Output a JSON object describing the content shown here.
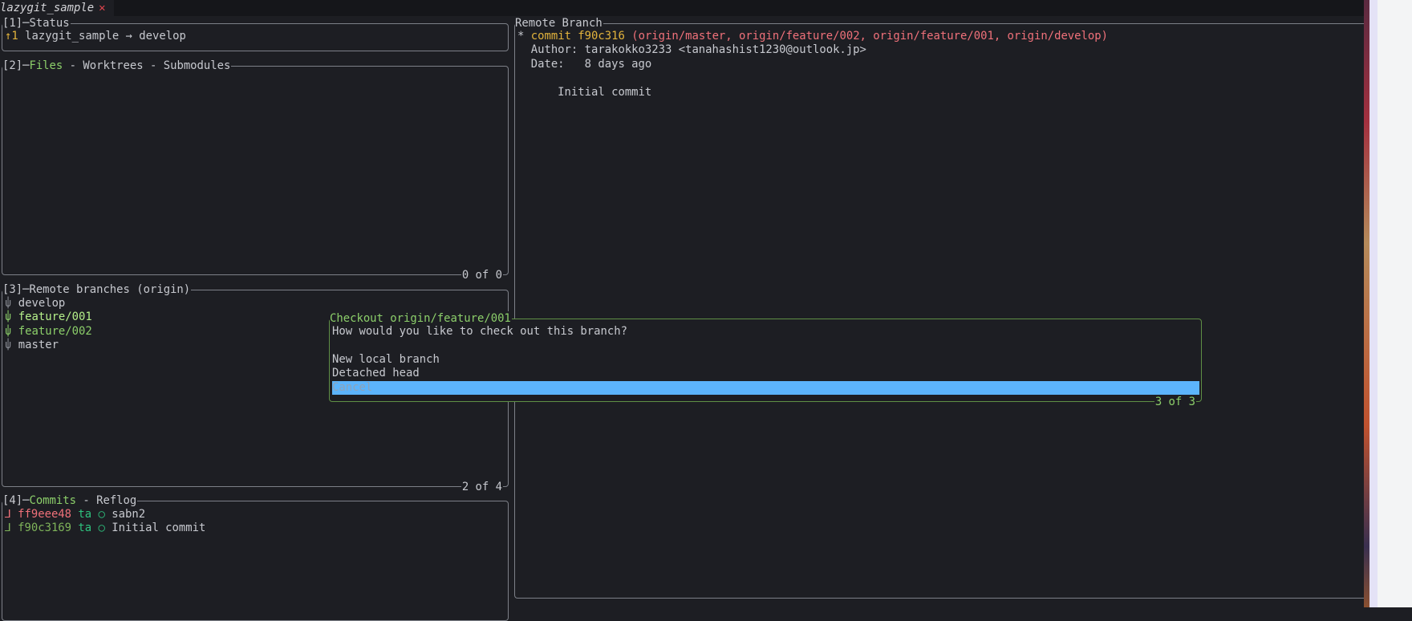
{
  "tab": {
    "title": "lazygit_sample",
    "close_icon": "✕"
  },
  "status": {
    "title": "[1]─Status",
    "ahead": "↑1",
    "text": "lazygit_sample → develop"
  },
  "files": {
    "prefix": "[2]─",
    "active": "Files",
    "rest": " - Worktrees - Submodules",
    "footer": "0 of 0"
  },
  "branches": {
    "title": "[3]─Remote branches (origin)",
    "footer": "2 of 4",
    "icon": "⍦",
    "items": [
      {
        "name": "develop"
      },
      {
        "name": "feature/001"
      },
      {
        "name": "feature/002"
      },
      {
        "name": "master"
      }
    ]
  },
  "commits": {
    "prefix": "[4]─",
    "active": "Commits",
    "rest": " - Reflog",
    "items": [
      {
        "graph": "⅃",
        "hash": "ff9eee48",
        "author": "ta",
        "mark": "○",
        "msg": "sabn2"
      },
      {
        "graph": "⅃",
        "hash": "f90c3169",
        "author": "ta",
        "mark": "○",
        "msg": "Initial commit"
      }
    ]
  },
  "detail": {
    "title": "Remote Branch",
    "star": "*",
    "commit_label": "commit f90c316",
    "refs": "(origin/master, origin/feature/002, origin/feature/001, origin/develop)",
    "author": "Author: tarakokko3233 <tanahashist1230@outlook.jp>",
    "date": "Date:   8 days ago",
    "message": "    Initial commit"
  },
  "popup": {
    "title": "Checkout origin/feature/001",
    "prompt": "How would you like to check out this branch?",
    "options": [
      "New local branch",
      "Detached head",
      "Cancel"
    ],
    "footer": "3 of 3"
  }
}
